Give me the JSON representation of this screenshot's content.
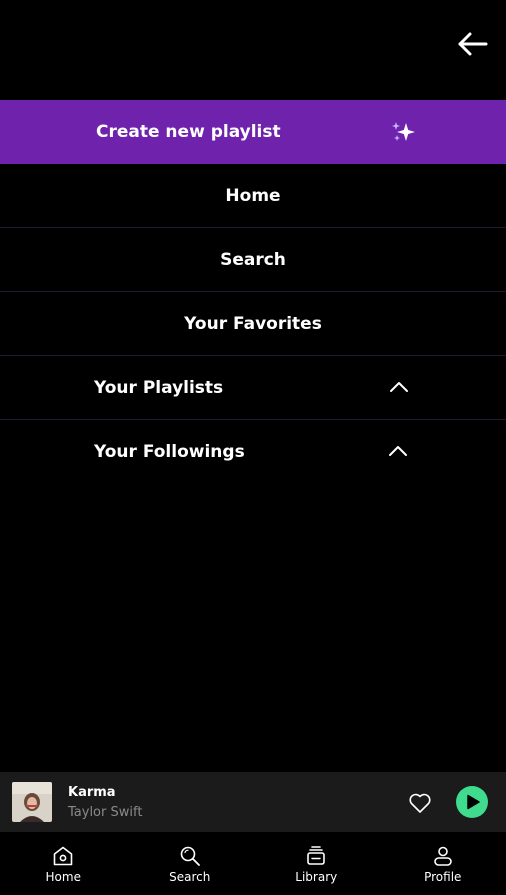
{
  "header": {
    "logo_icon": "waveform-icon",
    "back_icon": "arrow-left-icon"
  },
  "menu": {
    "create_label": "Create new playlist",
    "create_icon": "sparkles-icon",
    "accent_color": "#6f22ac",
    "items": [
      {
        "label": "Home"
      },
      {
        "label": "Search"
      },
      {
        "label": "Your Favorites"
      },
      {
        "label": "Your Playlists",
        "icon": "chevron-up-icon"
      },
      {
        "label": "Your Followings",
        "icon": "chevron-up-icon"
      }
    ]
  },
  "now_playing": {
    "title": "Karma",
    "artist": "Taylor Swift",
    "play_color": "#3fdc8d"
  },
  "bottom_nav": [
    {
      "label": "Home",
      "icon": "home-icon"
    },
    {
      "label": "Search",
      "icon": "search-icon"
    },
    {
      "label": "Library",
      "icon": "library-icon"
    },
    {
      "label": "Profile",
      "icon": "profile-icon"
    }
  ]
}
